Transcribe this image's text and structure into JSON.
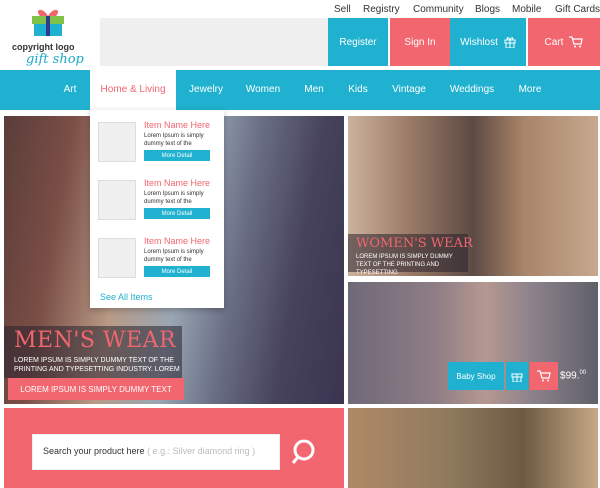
{
  "logo": {
    "line1": "copyright logo",
    "line2": "gift shop"
  },
  "top_links": [
    "Sell",
    "Registry",
    "Community",
    "Blogs",
    "Mobile",
    "Gift Cards"
  ],
  "header_buttons": {
    "register": "Register",
    "sign_in": "Sign In",
    "wishlist": "Wishlost",
    "cart": "Cart"
  },
  "nav": {
    "items": [
      "Art",
      "Home & Living",
      "Jewelry",
      "Women",
      "Men",
      "Kids",
      "Vintage",
      "Weddings",
      "More"
    ],
    "active": "Home & Living"
  },
  "dropdown": {
    "items": [
      {
        "name": "Item Name Here",
        "desc": "Lorem Ipsum is simply dummy text of the",
        "button": "More Detail"
      },
      {
        "name": "Item Name Here",
        "desc": "Lorem Ipsum is simply dummy text of the",
        "button": "More Detail"
      },
      {
        "name": "Item Name Here",
        "desc": "Lorem Ipsum is simply dummy text of the",
        "button": "More Detail"
      }
    ],
    "see_all": "See All Items"
  },
  "men": {
    "title": "MEN'S WEAR",
    "subtitle": "LOREM IPSUM IS SIMPLY DUMMY TEXT OF THE PRINTING AND TYPESETTING INDUSTRY. LOREM",
    "cta": "LOREM IPSUM IS SIMPLY DUMMY TEXT"
  },
  "women": {
    "title": "WOMEN'S WEAR",
    "subtitle": "LOREM IPSUM IS SIMPLY DUMMY TEXT OF THE PRINTING AND TYPESETTING"
  },
  "baby": {
    "label": "Baby Shop",
    "price_currency": "$",
    "price_main": "99",
    "price_cents": "00"
  },
  "search": {
    "label": "Search your product here",
    "placeholder": "( e.g.: Silver diamond ring )"
  },
  "colors": {
    "primary": "#1fb1cf",
    "accent": "#f1666f"
  }
}
